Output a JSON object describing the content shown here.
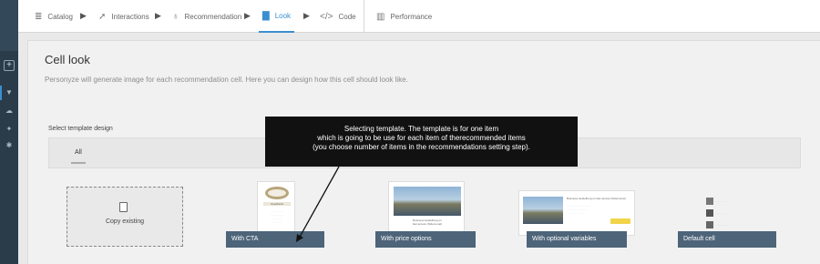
{
  "tabs": [
    {
      "label": "Catalog",
      "icon": "database-icon"
    },
    {
      "label": "Interactions",
      "icon": "cursor-icon"
    },
    {
      "label": "Recommendation",
      "icon": "lightbulb-icon"
    },
    {
      "label": "Look",
      "icon": "document-icon",
      "active": true
    },
    {
      "label": "Code",
      "icon": "code-icon"
    },
    {
      "label": "Performance",
      "icon": "bar-chart-icon"
    }
  ],
  "page": {
    "title": "Cell look",
    "description": "Personyze will generate image for each recommendation cell. Here you can design how this cell should look like."
  },
  "templates": {
    "section_label": "Select template design",
    "filter_tab": "All",
    "copy_label": "Copy existing",
    "cards": [
      {
        "caption": "With CTA"
      },
      {
        "caption": "With price options"
      },
      {
        "caption": "With optional variables"
      },
      {
        "caption": "Default cell"
      }
    ]
  },
  "tooltip": {
    "lines": [
      "Selecting template. The template is for one item",
      "which is going to be use for each item of  therecommended items",
      "(you choose number of items in the recommendations setting step)."
    ]
  },
  "thumbs": {
    "cta_title": "Headband",
    "price_title": "Business Heidelberg on\nfast access (Sidemonat)",
    "optional_title": "Business Heidelberg on fast access (Sidemonat)"
  },
  "colors": {
    "accent": "#3b8fd0",
    "caption_bg": "#4d6479",
    "rail_bg": "#2a3c49",
    "tooltip_bg": "#111111"
  }
}
